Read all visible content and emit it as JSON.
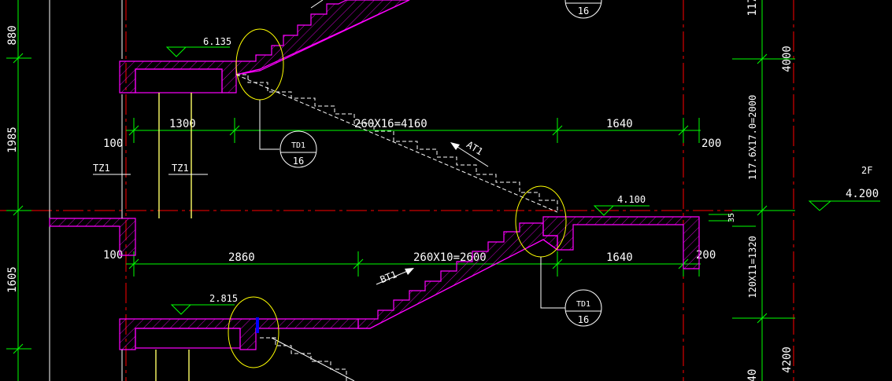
{
  "levels": {
    "level_upper": "6.135",
    "level_mid": "4.100",
    "level_lower": "2.815",
    "level_floor": "4.200",
    "floor_tag": "2F"
  },
  "dims_top": {
    "d1": "100",
    "d2": "1300",
    "d3": "260X16=4160",
    "d4": "1640",
    "d5": "200"
  },
  "dims_bottom": {
    "d1": "100",
    "d2": "2860",
    "d3": "260X10=2600",
    "d4": "1640",
    "d5": "200"
  },
  "dims_left": {
    "d1": "880",
    "d2": "1985",
    "d3": "1605"
  },
  "dims_right": {
    "d1": "117.6X17.0=2000",
    "d2": "4000",
    "d3": "120X11=1320",
    "d4": "35",
    "d5": "4200",
    "d6": "117",
    "d7": "40"
  },
  "labels": {
    "tz1_a": "TZ1",
    "tz1_b": "TZ1",
    "flight_upper": "AT1",
    "flight_lower": "BT1"
  },
  "details": {
    "detail_1": {
      "name": "TD1",
      "num": "16"
    },
    "detail_2": {
      "name": "TD1",
      "num": "16"
    },
    "detail_3": {
      "name": "",
      "num": "16"
    }
  }
}
